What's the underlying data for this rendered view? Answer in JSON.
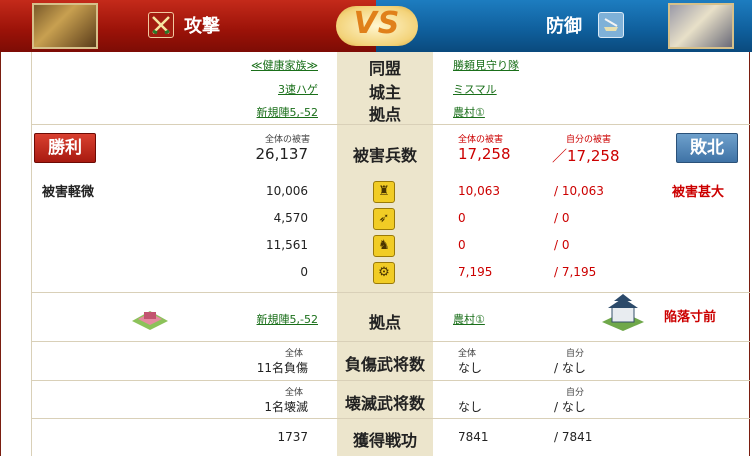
{
  "header": {
    "attacker_title": "攻撃",
    "defender_title": "防御",
    "vs": "VS",
    "colors": {
      "attacker": "#9a1208",
      "defender": "#0f5e9b",
      "accent": "#e0801a"
    },
    "icons": {
      "attacker": "crossed-swords-icon",
      "defender": "shield-sword-icon"
    }
  },
  "info": {
    "alliance": {
      "label": "同盟",
      "attacker": "≪健康家族≫",
      "defender": "勝頼見守り隊"
    },
    "lord": {
      "label": "城主",
      "attacker": "3速ハゲ",
      "defender": "ミスマル"
    },
    "base": {
      "label": "拠点",
      "attacker": "新規陣5,-52",
      "defender": "農村①"
    }
  },
  "damage": {
    "label": "被害兵数",
    "result_attacker": "勝利",
    "result_defender": "敗北",
    "att_total_label": "全体の被害",
    "att_total": "26,137",
    "def_total_label": "全体の被害",
    "def_total": "17,258",
    "def_self_label": "自分の被害",
    "def_self": "／17,258"
  },
  "units": {
    "att_status": "被害軽微",
    "def_status": "被害甚大",
    "rows": [
      {
        "icon": "spearman-icon",
        "att": "10,006",
        "def": "10,063",
        "def_self": "/ 10,063"
      },
      {
        "icon": "archer-icon",
        "att": "4,570",
        "def": "0",
        "def_self": "/ 0"
      },
      {
        "icon": "cavalry-icon",
        "att": "11,561",
        "def": "0",
        "def_self": "/ 0"
      },
      {
        "icon": "siege-icon",
        "att": "0",
        "def": "7,195",
        "def_self": "/ 7,195"
      }
    ]
  },
  "base_row": {
    "label": "拠点",
    "attacker": "新規陣5,-52",
    "defender": "農村①",
    "def_status": "陥落寸前"
  },
  "injured": {
    "label": "負傷武将数",
    "att_small": "全体",
    "att_value": "11名負傷",
    "def_total_small": "全体",
    "def_total": "なし",
    "def_self_small": "自分",
    "def_self": "/ なし"
  },
  "destroyed": {
    "label": "壊滅武将数",
    "att_small": "全体",
    "att_value": "1名壊滅",
    "def_total": "なし",
    "def_self_small": "自分",
    "def_self": "/ なし"
  },
  "merit": {
    "label": "獲得戦功",
    "att": "1737",
    "def": "7841",
    "def_self": "/ 7841"
  }
}
